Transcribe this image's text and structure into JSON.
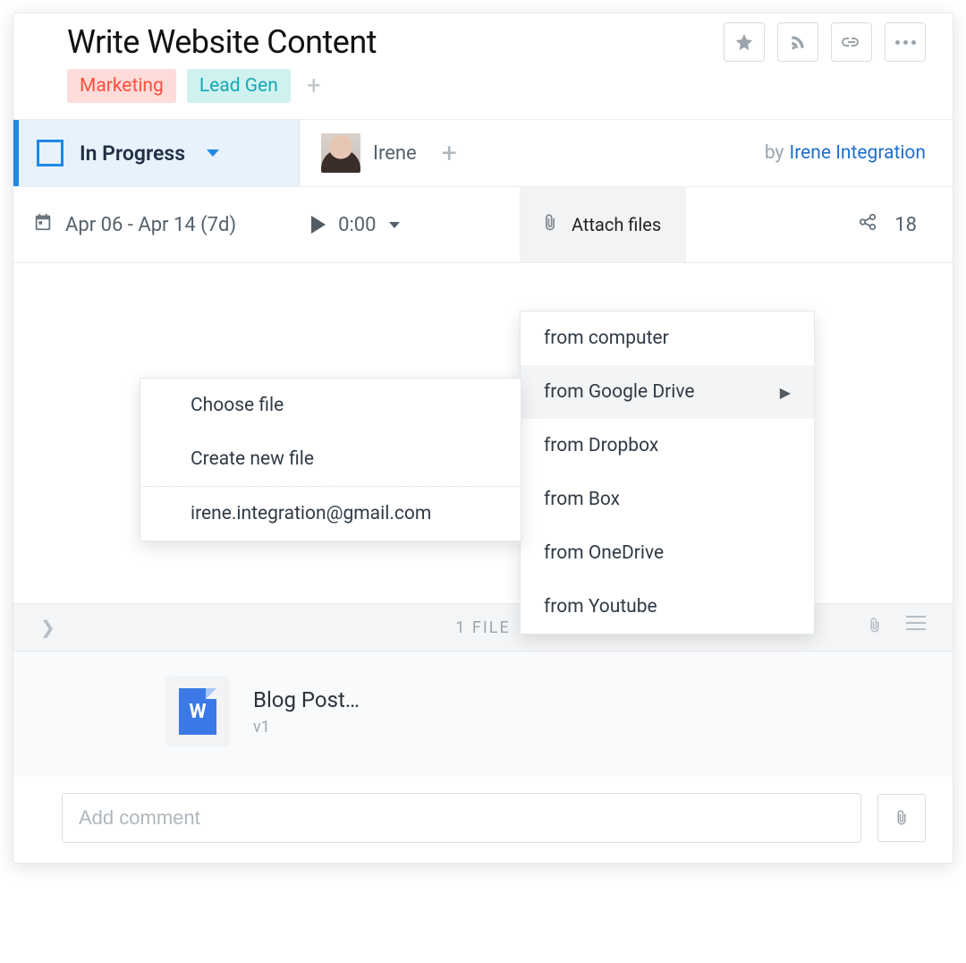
{
  "header": {
    "title": "Write Website Content"
  },
  "tags": [
    {
      "label": "Marketing",
      "variant": "red"
    },
    {
      "label": "Lead Gen",
      "variant": "teal"
    }
  ],
  "status": {
    "label": "In Progress"
  },
  "assignee": {
    "name": "Irene"
  },
  "author": {
    "prefix": "by",
    "name": "Irene Integration"
  },
  "meta": {
    "date_range": "Apr 06 - Apr 14 (7d)",
    "timer": "0:00",
    "attach_label": "Attach files",
    "share_count": "18"
  },
  "attach_menu": [
    "from computer",
    "from Google Drive",
    "from Dropbox",
    "from Box",
    "from OneDrive",
    "from Youtube"
  ],
  "gdrive_submenu": {
    "choose": "Choose file",
    "create": "Create new file",
    "account": "irene.integration@gmail.com"
  },
  "files": {
    "count_label": "1 FILE",
    "item": {
      "name": "Blog Post…",
      "version": "v1",
      "glyph": "W"
    }
  },
  "comment": {
    "placeholder": "Add comment"
  }
}
